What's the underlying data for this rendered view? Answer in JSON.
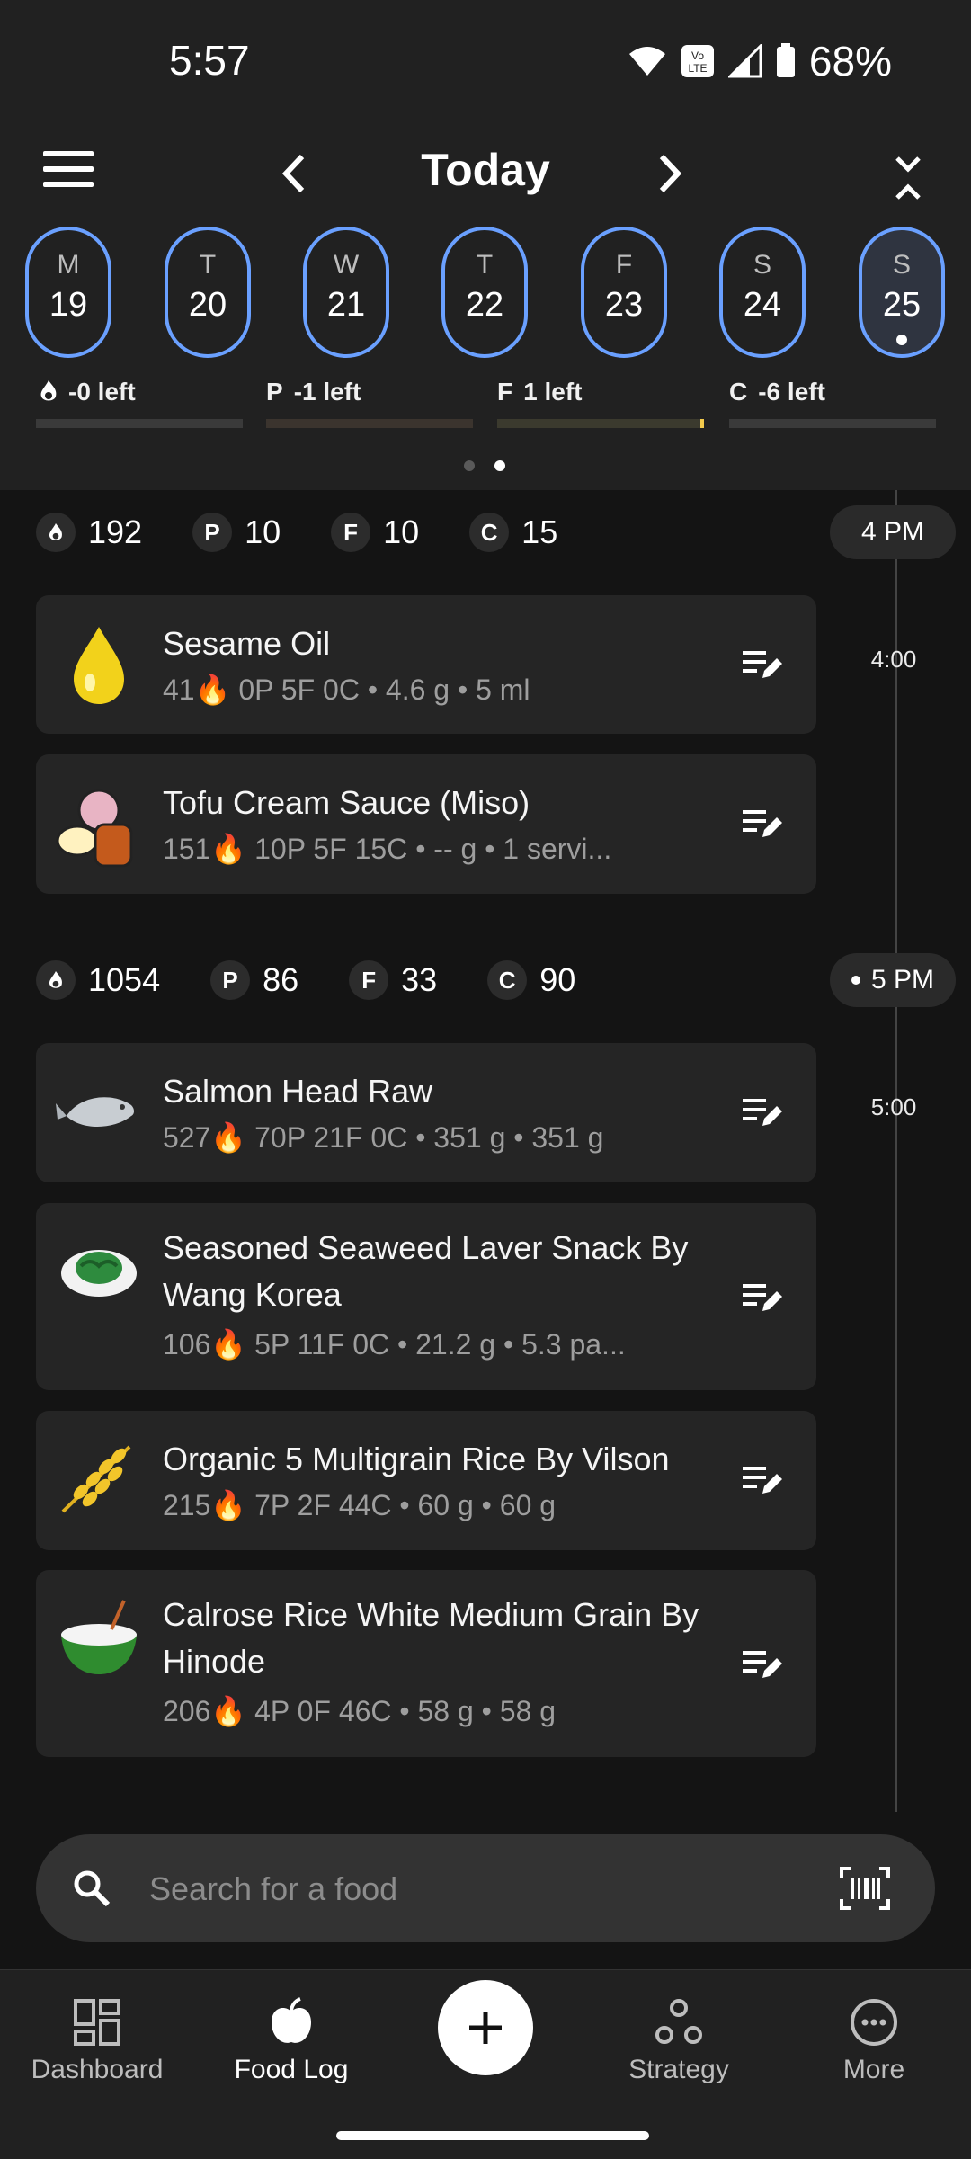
{
  "status": {
    "time": "5:57",
    "battery": "68%"
  },
  "header": {
    "title": "Today"
  },
  "week": [
    {
      "dow": "M",
      "num": "19"
    },
    {
      "dow": "T",
      "num": "20"
    },
    {
      "dow": "W",
      "num": "21"
    },
    {
      "dow": "T",
      "num": "22"
    },
    {
      "dow": "F",
      "num": "23"
    },
    {
      "dow": "S",
      "num": "24"
    },
    {
      "dow": "S",
      "num": "25"
    }
  ],
  "targets": {
    "cal": {
      "label": "-0 left"
    },
    "p": {
      "letter": "P",
      "label": "-1 left"
    },
    "f": {
      "letter": "F",
      "label": "1 left"
    },
    "c": {
      "letter": "C",
      "label": "-6 left"
    }
  },
  "groups": [
    {
      "time_pill": "4 PM",
      "time_mark": "4:00",
      "totals": {
        "cal": "192",
        "p": "10",
        "f": "10",
        "c": "15"
      },
      "entries": [
        {
          "name": "Sesame Oil",
          "detail": "41🔥 0P  5F  0C • 4.6 g • 5 ml",
          "icon": "oil-drop-icon"
        },
        {
          "name": "Tofu Cream Sauce (Miso)",
          "detail": "151🔥 10P  5F  15C • -- g • 1 servi...",
          "icon": "sauce-icon"
        }
      ]
    },
    {
      "time_pill": "5 PM",
      "time_mark": "5:00",
      "totals": {
        "cal": "1054",
        "p": "86",
        "f": "33",
        "c": "90"
      },
      "entries": [
        {
          "name": "Salmon Head Raw",
          "detail": "527🔥 70P  21F  0C • 351 g • 351 g",
          "icon": "fish-icon"
        },
        {
          "name": "Seasoned Seaweed Laver Snack By Wang Korea",
          "detail": "106🔥 5P  11F  0C • 21.2 g • 5.3 pa...",
          "icon": "seaweed-icon"
        },
        {
          "name": "Organic 5 Multigrain Rice By Vilson",
          "detail": "215🔥 7P  2F  44C • 60 g • 60 g",
          "icon": "grain-icon"
        },
        {
          "name": "Calrose Rice White Medium Grain By Hinode",
          "detail": "206🔥 4P  0F  46C • 58 g • 58 g",
          "icon": "rice-bowl-icon"
        }
      ]
    }
  ],
  "search": {
    "placeholder": "Search for a food"
  },
  "nav": {
    "dashboard": "Dashboard",
    "food_log": "Food Log",
    "strategy": "Strategy",
    "more": "More"
  },
  "colors": {
    "accent": "#6aa0ff",
    "background": "#141414",
    "card": "#252525"
  }
}
